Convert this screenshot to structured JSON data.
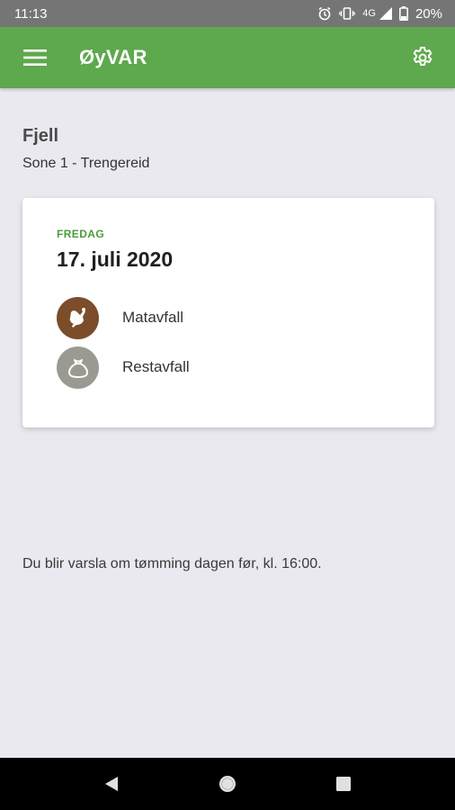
{
  "statusbar": {
    "time": "11:13",
    "network": "4G",
    "battery": "20%",
    "icons": [
      "alarm-icon",
      "vibrate-icon",
      "signal-icon",
      "battery-icon"
    ]
  },
  "appbar": {
    "title": "ØyVAR",
    "color": "#5ea84d"
  },
  "location": {
    "name": "Fjell",
    "zone": "Sone 1 - Trengereid"
  },
  "pickup": {
    "day": "FREDAG",
    "date": "17. juli 2020",
    "items": [
      {
        "label": "Matavfall",
        "icon": "food-waste-icon",
        "color": "#7b4d2a"
      },
      {
        "label": "Restavfall",
        "icon": "residual-waste-icon",
        "color": "#9b9a92"
      }
    ]
  },
  "notice": "Du blir varsla om tømming dagen før, kl. 16:00."
}
